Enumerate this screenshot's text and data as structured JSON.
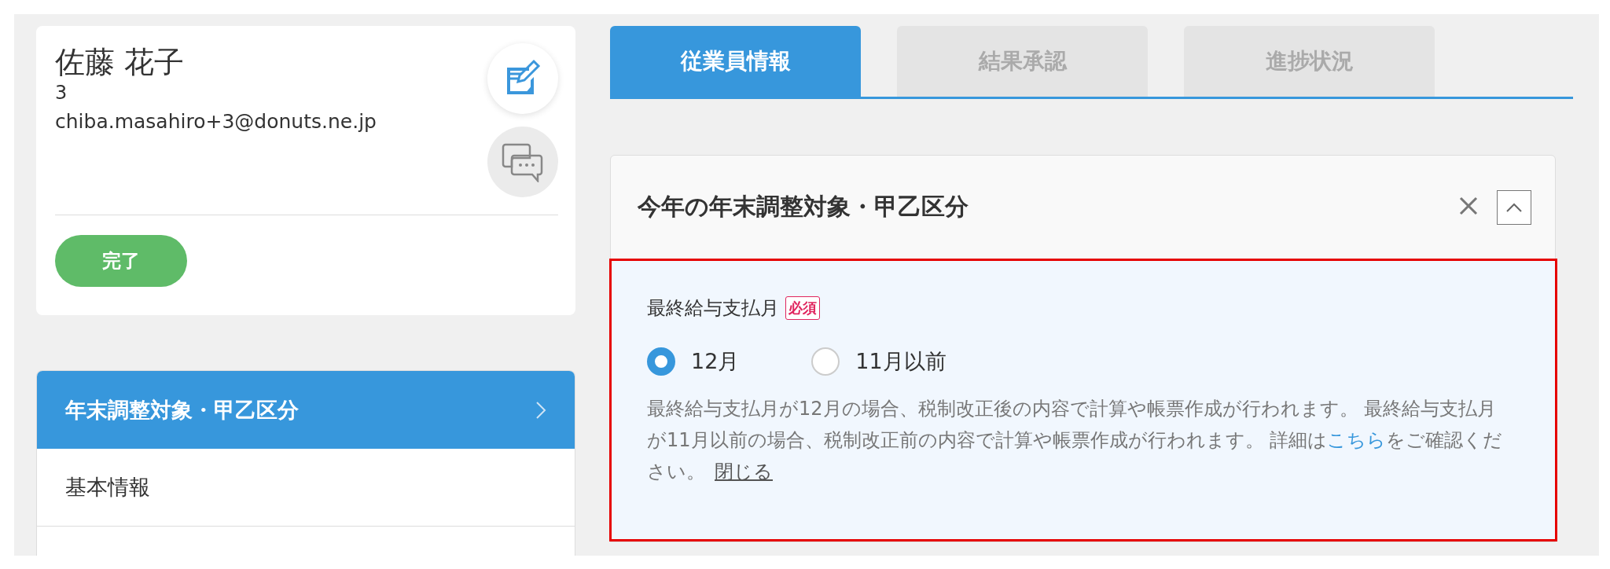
{
  "profile": {
    "name": "佐藤 花子",
    "number": "3",
    "email": "chiba.masahiro+3@donuts.ne.jp",
    "status": "完了"
  },
  "nav": {
    "items": [
      {
        "label": "年末調整対象・甲乙区分",
        "selected": true
      },
      {
        "label": "基本情報",
        "selected": false
      }
    ]
  },
  "tabs": [
    {
      "label": "従業員情報",
      "selected": true
    },
    {
      "label": "結果承認",
      "selected": false
    },
    {
      "label": "進捗状況",
      "selected": false
    }
  ],
  "section": {
    "title": "今年の年末調整対象・甲乙区分",
    "expanded": true,
    "field": {
      "label": "最終給与支払月",
      "required_badge": "必須",
      "options": [
        {
          "label": "12月",
          "selected": true
        },
        {
          "label": "11月以前",
          "selected": false
        }
      ],
      "help": {
        "text": "最終給与支払月が12月の場合、税制改正後の内容で計算や帳票作成が行われます。 最終給与支払月が11月以前の場合、税制改正前の内容で計算や帳票作成が行われます。 詳細は",
        "link": "こちら",
        "after": "をご確認ください。",
        "close": "閉じる"
      }
    }
  }
}
